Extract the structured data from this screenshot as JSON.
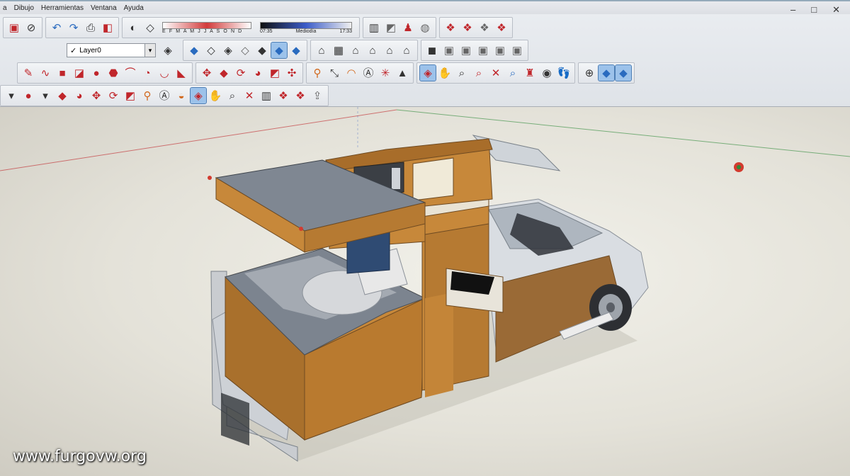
{
  "menu": {
    "items": [
      "a",
      "Dibujo",
      "Herramientas",
      "Ventana",
      "Ayuda"
    ]
  },
  "shadow_settings": {
    "months_label": "E F M A M J J A S O N D",
    "time_start": "07:35",
    "time_mid": "Mediodía",
    "time_end": "17:33"
  },
  "layers": {
    "current": "Layer0"
  },
  "watermark": "www.furgovw.org",
  "icons": {
    "row1": [
      "save-icon",
      "eraser-icon",
      "undo-icon",
      "redo-icon",
      "print-icon",
      "model-info-icon",
      "shadows-icon",
      "fog-icon",
      "walkthrough-icon",
      "position-camera-icon",
      "look-around-icon",
      "get-models-icon",
      "share-model-icon",
      "warehouse-icon",
      "extension-1-icon",
      "extension-2-icon",
      "extension-3-icon",
      "extension-4-icon"
    ],
    "row2": [
      "layer-manager-icon",
      "xray-icon",
      "back-edges-icon",
      "wireframe-icon",
      "hidden-line-icon",
      "shaded-icon",
      "shaded-textures-icon",
      "monochrome-icon",
      "iso-view-icon",
      "top-view-icon",
      "front-view-icon",
      "right-view-icon",
      "back-view-icon",
      "left-view-icon",
      "solid-tools-icon",
      "outer-shell-icon",
      "intersect-icon",
      "union-icon",
      "subtract-icon",
      "trim-icon"
    ],
    "row3": [
      "pencil-icon",
      "freehand-icon",
      "rectangle-icon",
      "rotated-rectangle-icon",
      "circle-icon",
      "polygon-icon",
      "arc-icon",
      "pie-icon",
      "3point-arc-icon",
      "2point-arc-icon",
      "move-icon",
      "push-pull-icon",
      "rotate-icon",
      "follow-me-icon",
      "scale-icon",
      "offset-icon",
      "tape-measure-icon",
      "dimension-icon",
      "protractor-icon",
      "text-icon",
      "axes-icon",
      "3d-text-icon",
      "orbit-icon",
      "pan-icon",
      "zoom-icon",
      "zoom-window-icon",
      "zoom-extents-icon",
      "zoom-previous-icon",
      "position-camera-2-icon",
      "look-around-2-icon",
      "walk-icon",
      "section-plane-icon",
      "display-sections-icon",
      "section-cuts-icon"
    ],
    "row4": [
      "arc-dropdown-icon",
      "circle-dropdown-icon",
      "push-pull-2-icon",
      "follow-me-2-icon",
      "move-2-icon",
      "rotate-2-icon",
      "scale-2-icon",
      "tape-2-icon",
      "text-2-icon",
      "paint-bucket-icon",
      "orbit-2-icon",
      "pan-2-icon",
      "zoom-2-icon",
      "zoom-extents-2-icon",
      "components-icon",
      "materials-icon",
      "styles-icon",
      "send-to-layout-icon"
    ]
  },
  "colors": {
    "accent_active": "#9cc2ea",
    "sky": "#e8e6de",
    "wood": "#c7883a",
    "gray_panel": "#7c848f",
    "red_axis": "#c0262b",
    "green_axis": "#2f8b3a"
  }
}
